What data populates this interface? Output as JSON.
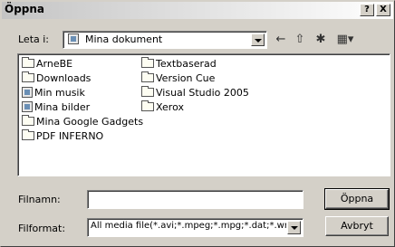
{
  "window": {
    "title": "Öppna",
    "help": "?",
    "close": "X"
  },
  "lookin": {
    "label": "Leta i:",
    "value": "Mina dokument"
  },
  "toolbar": {
    "back": "←",
    "up": "⇧",
    "newfolder": "✱",
    "views": "▦▾"
  },
  "files": [
    {
      "name": "ArneBE",
      "icon": "folder-icon"
    },
    {
      "name": "Downloads",
      "icon": "folder-icon"
    },
    {
      "name": "Min musik",
      "icon": "music-folder-icon"
    },
    {
      "name": "Mina bilder",
      "icon": "pictures-folder-icon"
    },
    {
      "name": "Mina Google Gadgets",
      "icon": "folder-icon"
    },
    {
      "name": "PDF INFERNO",
      "icon": "folder-icon"
    },
    {
      "name": "Textbaserad",
      "icon": "folder-icon"
    },
    {
      "name": "Version Cue",
      "icon": "folder-icon"
    },
    {
      "name": "Visual Studio 2005",
      "icon": "folder-icon"
    },
    {
      "name": "Xerox",
      "icon": "folder-icon"
    }
  ],
  "filename": {
    "label": "Filnamn:",
    "value": ""
  },
  "filetype": {
    "label": "Filformat:",
    "value": "All media file(*.avi;*.mpeg;*.mpg;*.dat;*.wmv;*"
  },
  "buttons": {
    "open": "Öppna",
    "cancel": "Avbryt"
  }
}
